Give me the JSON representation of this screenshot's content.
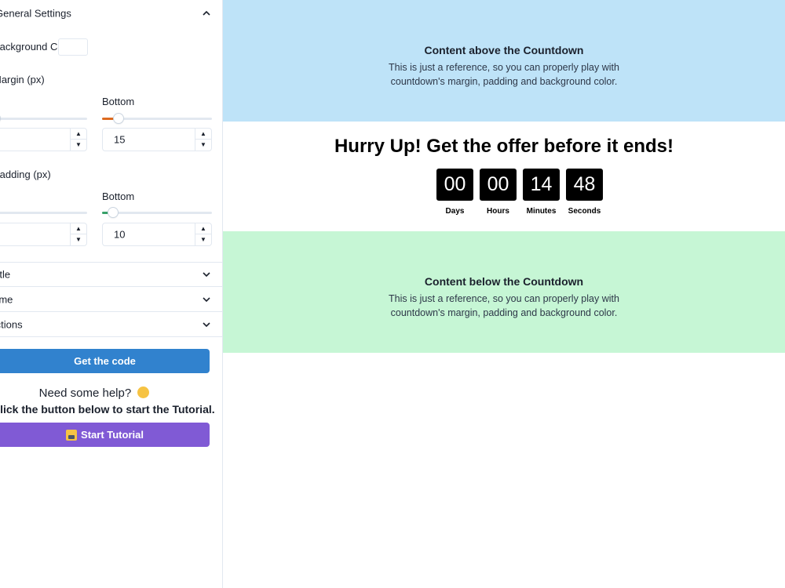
{
  "sidebar": {
    "general_settings": "General Settings",
    "background_color_label": "Background Color",
    "background_color_value": "#ffffff",
    "margin": {
      "label": "Margin (px)",
      "bottom_label": "Bottom",
      "bottom_value": "15",
      "bottom_slider_fraction": 0.15,
      "bottom_slider_color": "#dd6b20"
    },
    "padding": {
      "label": "Padding (px)",
      "bottom_label": "Bottom",
      "bottom_value": "10",
      "bottom_slider_fraction": 0.1,
      "bottom_slider_color": "#38a169"
    },
    "sections": [
      "Title",
      "Time",
      "Actions"
    ],
    "get_code_label": "Get the code",
    "help_title": "Need some help?",
    "help_subtitle": "Click the button below to start the Tutorial.",
    "start_tutorial_label": "Start Tutorial"
  },
  "preview": {
    "above": {
      "title": "Content above the Countdown",
      "line1": "This is just a reference, so you can properly play with",
      "line2": "countdown's margin, padding and background color.",
      "bg_color": "#bee3f8"
    },
    "countdown": {
      "headline": "Hurry Up! Get the offer before it ends!",
      "units": [
        {
          "value": "00",
          "label": "Days"
        },
        {
          "value": "00",
          "label": "Hours"
        },
        {
          "value": "14",
          "label": "Minutes"
        },
        {
          "value": "48",
          "label": "Seconds"
        }
      ]
    },
    "below": {
      "title": "Content below the Countdown",
      "line1": "This is just a reference, so you can properly play with",
      "line2": "countdown's margin, padding and background color.",
      "bg_color": "#c6f6d5"
    }
  },
  "colors": {
    "primary_button": "#3182ce",
    "tutorial_button": "#805ad5"
  }
}
